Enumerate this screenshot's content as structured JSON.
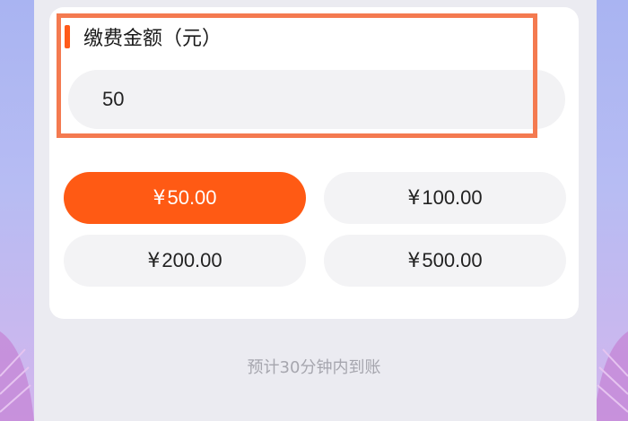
{
  "payment_section": {
    "title": "缴费金额（元）",
    "amount_value": "50"
  },
  "amount_options": [
    {
      "symbol": "¥",
      "amount": "50.00",
      "selected": true
    },
    {
      "symbol": "¥",
      "amount": "100.00",
      "selected": false
    },
    {
      "symbol": "¥",
      "amount": "200.00",
      "selected": false
    },
    {
      "symbol": "¥",
      "amount": "500.00",
      "selected": false
    }
  ],
  "arrival_note": "预计30分钟内到账",
  "colors": {
    "accent": "#ff5a14",
    "highlight_border": "#f47a50",
    "background": "#a9b4f2"
  }
}
